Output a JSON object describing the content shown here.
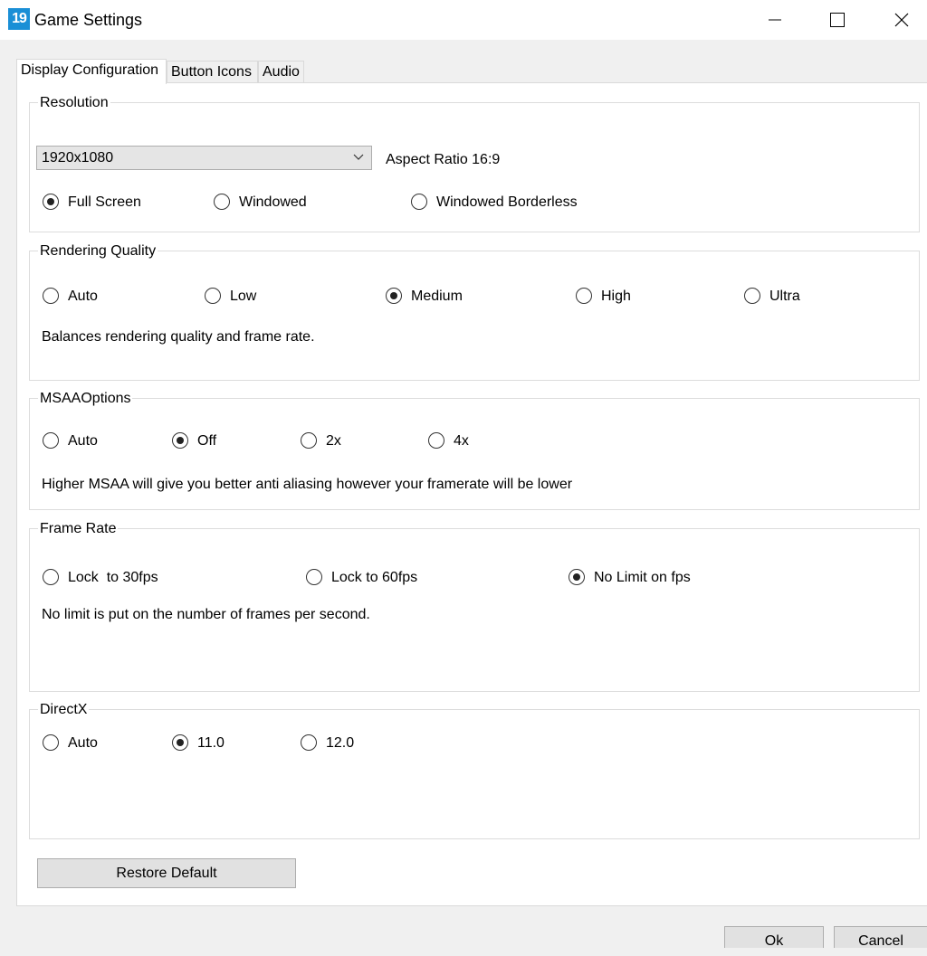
{
  "window": {
    "icon_text": "19",
    "title": "Game Settings"
  },
  "tabs": [
    "Display Configuration",
    "Button Icons",
    "Audio"
  ],
  "resolution": {
    "legend": "Resolution",
    "selected": "1920x1080",
    "aspect_label": "Aspect Ratio 16:9",
    "modes": [
      {
        "label": "Full Screen",
        "checked": true
      },
      {
        "label": "Windowed",
        "checked": false
      },
      {
        "label": "Windowed Borderless",
        "checked": false
      }
    ]
  },
  "rendering": {
    "legend": "Rendering Quality",
    "options": [
      {
        "label": "Auto",
        "checked": false
      },
      {
        "label": "Low",
        "checked": false
      },
      {
        "label": "Medium",
        "checked": true
      },
      {
        "label": "High",
        "checked": false
      },
      {
        "label": "Ultra",
        "checked": false
      }
    ],
    "description": "Balances rendering quality and frame rate."
  },
  "msaa": {
    "legend": "MSAAOptions",
    "options": [
      {
        "label": "Auto",
        "checked": false
      },
      {
        "label": "Off",
        "checked": true
      },
      {
        "label": "2x",
        "checked": false
      },
      {
        "label": "4x",
        "checked": false
      }
    ],
    "description": "Higher MSAA will give you better anti aliasing however your framerate will be lower"
  },
  "framerate": {
    "legend": "Frame Rate",
    "options": [
      {
        "label": "Lock  to 30fps",
        "checked": false
      },
      {
        "label": "Lock to 60fps",
        "checked": false
      },
      {
        "label": "No Limit on fps",
        "checked": true
      }
    ],
    "description": "No limit is put on the number of frames per second."
  },
  "directx": {
    "legend": "DirectX",
    "options": [
      {
        "label": "Auto",
        "checked": false
      },
      {
        "label": "11.0",
        "checked": true
      },
      {
        "label": "12.0",
        "checked": false
      }
    ]
  },
  "buttons": {
    "restore": "Restore Default",
    "ok": "Ok",
    "cancel": "Cancel"
  }
}
